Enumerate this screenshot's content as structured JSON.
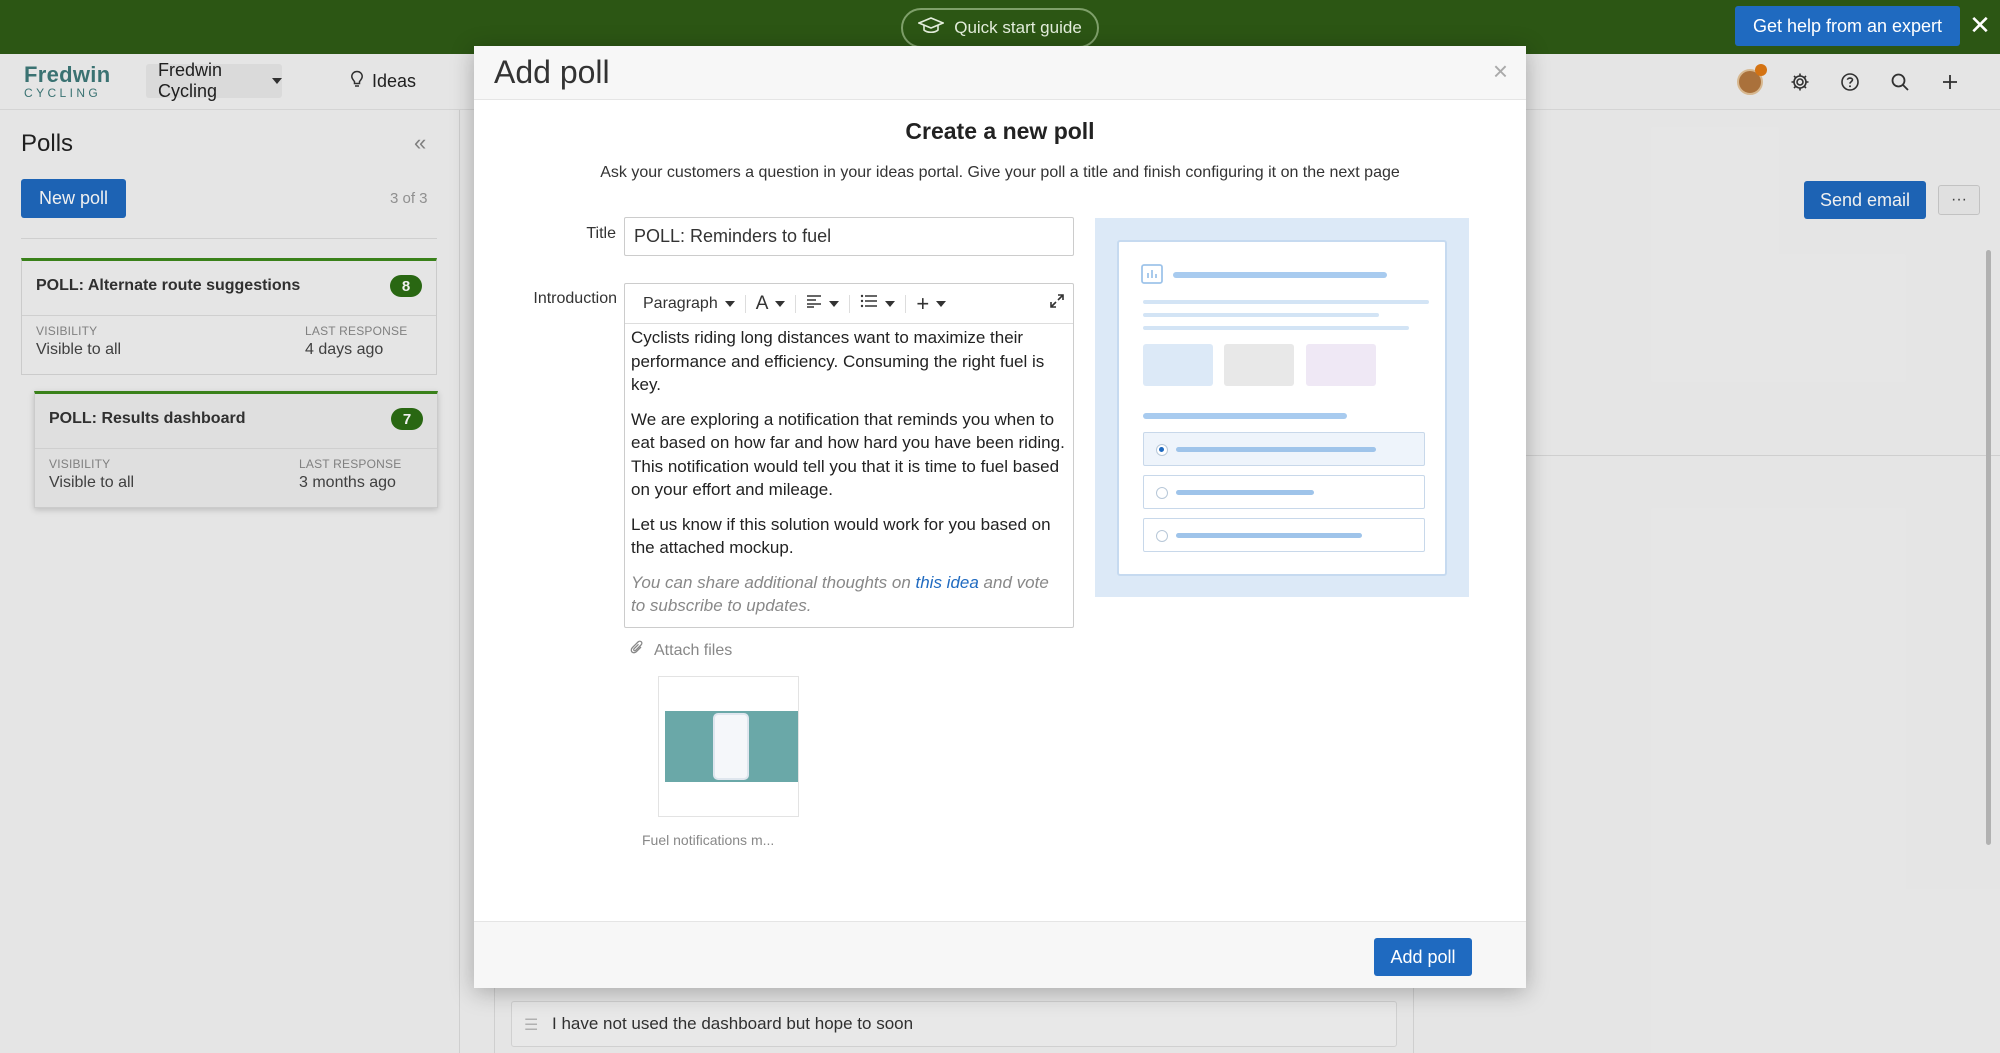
{
  "banner": {
    "quick_start": "Quick start guide",
    "help": "Get help from an expert",
    "close": "✕"
  },
  "header": {
    "logo_line1": "Fredwin",
    "logo_line2": "CYCLING",
    "workspace": "Fredwin Cycling",
    "nav_ideas": "Ideas",
    "icons": [
      "avatar",
      "gear-icon",
      "help-icon",
      "search-icon",
      "plus-icon"
    ]
  },
  "sidebar": {
    "title": "Polls",
    "collapse": "«",
    "new_poll": "New poll",
    "count": "3 of 3",
    "cards": [
      {
        "title": "POLL: Alternate route suggestions",
        "badge": "8",
        "visibility_label": "VISIBILITY",
        "visibility": "Visible to all",
        "last_label": "LAST RESPONSE",
        "last": "4 days ago"
      },
      {
        "title": "POLL: Results dashboard",
        "badge": "7",
        "visibility_label": "VISIBILITY",
        "visibility": "Visible to all",
        "last_label": "LAST RESPONSE",
        "last": "3 months ago"
      }
    ]
  },
  "main": {
    "send_email": "Send email",
    "more": "···",
    "answer": "I have not used the dashboard but hope to soon"
  },
  "modal": {
    "title": "Add poll",
    "close": "×",
    "heading": "Create a new poll",
    "subheading": "Ask your customers a question in your ideas portal. Give your poll a title and finish configuring it on the next page",
    "title_label": "Title",
    "title_value": "POLL: Reminders to fuel",
    "intro_label": "Introduction",
    "toolbar": {
      "paragraph": "Paragraph",
      "font": "A",
      "plus": "+"
    },
    "intro_p1": "Cyclists riding long distances want to maximize their performance and efficiency. Consuming the right fuel is key.",
    "intro_p2": "We are exploring a notification that reminds you when to eat based on how far and how hard you have been riding. This notification would tell you that it is time to fuel based on your effort and mileage.",
    "intro_p3": "Let us know if this solution would work for you based on the attached mockup.",
    "intro_p4_a": "You can share additional thoughts on ",
    "intro_p4_link": "this idea",
    "intro_p4_b": " and vote to subscribe to updates.",
    "attach": "Attach files",
    "file_caption": "Fuel notifications m...",
    "submit": "Add poll"
  },
  "colors": {
    "banner": "#2c5614",
    "primary": "#1f6ac0",
    "badge": "#2c6e14",
    "card_accent": "#3d8a1c"
  }
}
